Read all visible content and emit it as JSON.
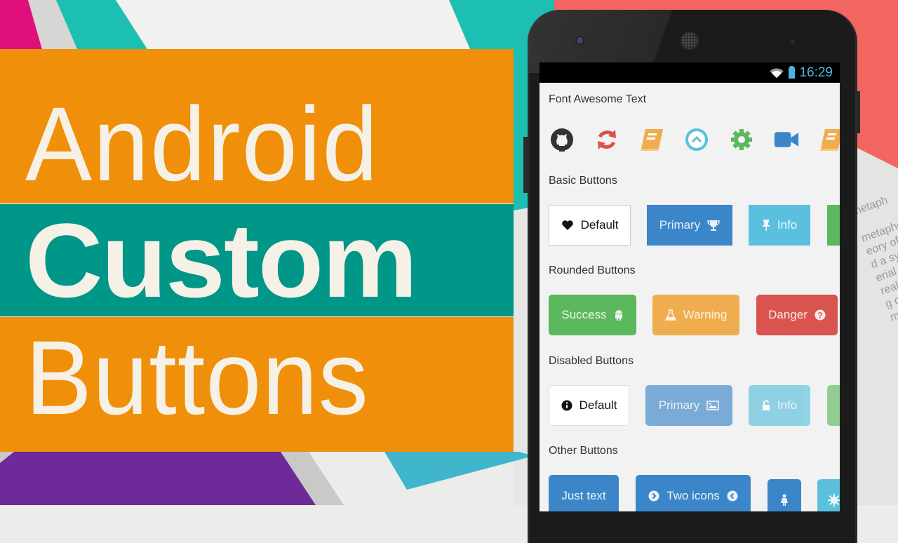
{
  "title": {
    "line1": "Android",
    "line2": "Custom",
    "line3": "Buttons"
  },
  "colors": {
    "orange": "#ef8f0a",
    "teal": "#009688",
    "primary": "#3b86c8",
    "info": "#5bc0de",
    "success": "#5cb85c",
    "warning": "#f0ad4e",
    "danger": "#d9534f"
  },
  "statusbar": {
    "time": "16:29",
    "icons": [
      "wifi-icon",
      "battery-icon"
    ]
  },
  "sections": {
    "font_awesome": {
      "label": "Font Awesome Text",
      "icons": [
        "github-icon",
        "refresh-icon",
        "book-icon",
        "chevron-circle-up-icon",
        "cog-icon",
        "video-camera-icon",
        "book-icon"
      ]
    },
    "basic": {
      "label": "Basic Buttons",
      "buttons": [
        {
          "label": "Default",
          "icon": "heart-icon",
          "style": "default"
        },
        {
          "label": "Primary",
          "icon": "trophy-icon",
          "style": "primary"
        },
        {
          "label": "Info",
          "icon": "thumb-tack-icon",
          "style": "info"
        },
        {
          "label": "",
          "icon": "",
          "style": "success"
        }
      ]
    },
    "rounded": {
      "label": "Rounded Buttons",
      "buttons": [
        {
          "label": "Success",
          "icon": "android-icon",
          "style": "success"
        },
        {
          "label": "Warning",
          "icon": "flask-icon",
          "style": "warning"
        },
        {
          "label": "Danger",
          "icon": "question-circle-icon",
          "style": "danger"
        }
      ]
    },
    "disabled": {
      "label": "Disabled Buttons",
      "buttons": [
        {
          "label": "Default",
          "icon": "info-circle-icon",
          "style": "default"
        },
        {
          "label": "Primary",
          "icon": "picture-icon",
          "style": "primary"
        },
        {
          "label": "Info",
          "icon": "unlock-icon",
          "style": "info"
        },
        {
          "label": "",
          "icon": "",
          "style": "success"
        }
      ]
    },
    "other": {
      "label": "Other Buttons",
      "buttons": [
        {
          "label": "Just text",
          "style": "primary"
        },
        {
          "label": "Two icons",
          "icon_left": "chevron-circle-right-icon",
          "icon_right": "chevron-circle-left-icon",
          "style": "primary"
        },
        {
          "label": "",
          "icon": "female-icon",
          "style": "primary"
        },
        {
          "label": "",
          "icon": "sun-icon",
          "style": "info"
        }
      ]
    }
  },
  "background_text": [
    "metaph",
    "metaphor",
    "eory of a",
    "d a syst",
    "erial is",
    "reality,",
    "g of pap",
    "magina"
  ]
}
